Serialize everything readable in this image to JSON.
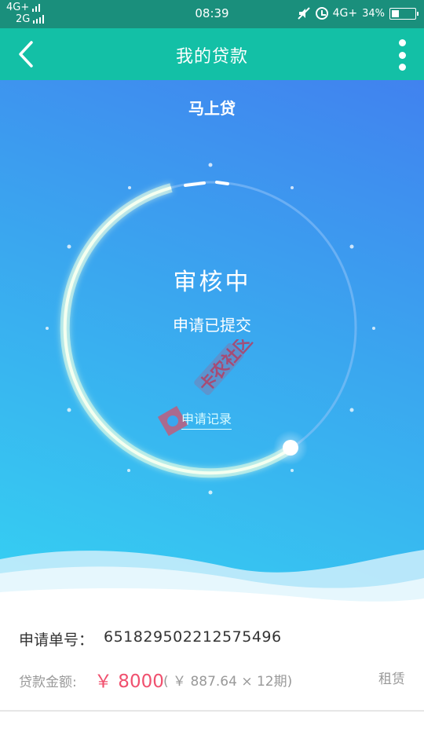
{
  "status_bar": {
    "net_top": "4G+",
    "net_bottom": "2G",
    "time": "08:39",
    "net_right": "4G+",
    "battery_text": "34%",
    "battery_level": 0.34,
    "icons": [
      "signal-icon",
      "mute-icon",
      "alarm-icon",
      "battery-icon"
    ]
  },
  "header": {
    "title": "我的贷款",
    "back_icon": "chevron-left-icon",
    "more_icon": "more-vertical-icon"
  },
  "hero": {
    "product_name": "马上贷",
    "status": "审核中",
    "substatus": "申请已提交",
    "records_link": "申请记录"
  },
  "loan": {
    "order_label": "申请单号：",
    "order_number": "651829502212575496",
    "amount_label": "贷款金额:",
    "amount": "￥ 8000",
    "installment": "( ￥ 887.64 × 12期)",
    "type": "租赁"
  },
  "colors": {
    "status_bar": "#1a8f7c",
    "header": "#13c0a6",
    "hero_top": "#4182ef",
    "hero_bottom": "#35d2f2",
    "amount": "#f0506e"
  }
}
